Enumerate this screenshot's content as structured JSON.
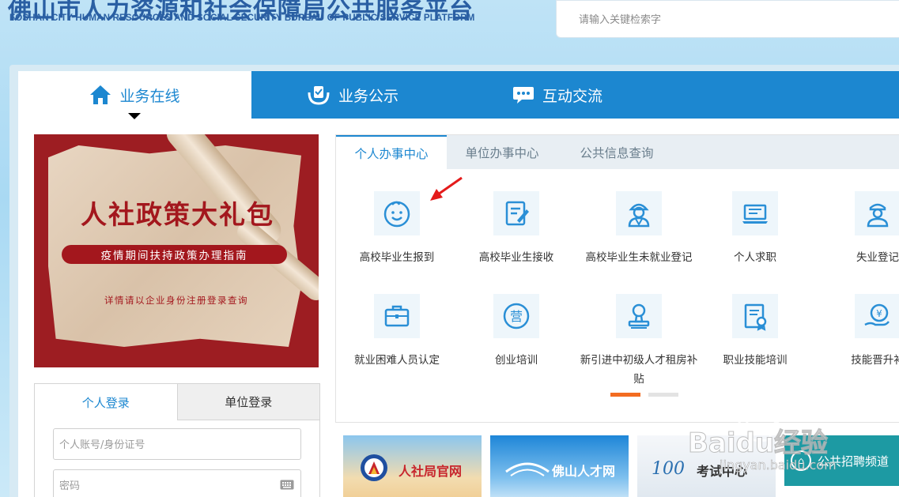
{
  "header": {
    "title": "佛山市人力资源和社会保障局公共服务平台",
    "subtitle": "FOSHAN CITY HUMAN RESOURCES AND SOCIAL SECURITY BUREAU OF PUBLIC SERVICE PLATFORM",
    "search_placeholder": "请输入关键检索字"
  },
  "main_tabs": [
    {
      "label": "业务在线",
      "icon": "home-icon"
    },
    {
      "label": "业务公示",
      "icon": "clipboard-check-icon"
    },
    {
      "label": "互动交流",
      "icon": "chat-bubble-icon"
    }
  ],
  "banner": {
    "title": "人社政策大礼包",
    "pill": "疫情期间扶持政策办理指南",
    "note": "详情请以企业身份注册登录查询"
  },
  "login": {
    "tabs": [
      "个人登录",
      "单位登录"
    ],
    "account_placeholder": "个人账号/身份证号",
    "password_placeholder": "密码"
  },
  "service": {
    "tabs": [
      "个人办事中心",
      "单位办事中心",
      "公共信息查询"
    ],
    "items_row1": [
      {
        "label": "高校毕业生报到",
        "icon": "baby-face-icon"
      },
      {
        "label": "高校毕业生接收",
        "icon": "document-edit-icon"
      },
      {
        "label": "高校毕业生未就业登记",
        "icon": "worker-icon"
      },
      {
        "label": "个人求职",
        "icon": "computer-icon"
      },
      {
        "label": "失业登记",
        "icon": "person-cap-icon"
      }
    ],
    "items_row2": [
      {
        "label": "就业困难人员认定",
        "icon": "briefcase-icon"
      },
      {
        "label": "创业培训",
        "icon": "ying-circle-icon"
      },
      {
        "label": "新引进中初级人才租房补贴",
        "icon": "stamp-icon"
      },
      {
        "label": "职业技能培训",
        "icon": "certificate-icon"
      },
      {
        "label": "技能晋升补",
        "icon": "yuan-hand-icon"
      }
    ]
  },
  "cards": [
    {
      "label": "人社局官网"
    },
    {
      "label": "佛山人才网"
    },
    {
      "label": "考试中心"
    }
  ],
  "recruit": {
    "label": "公共招聘频道"
  },
  "watermark": {
    "brand": "Baidu经验",
    "url": "jingyan.baidu.com"
  },
  "colors": {
    "primary": "#1c87d0",
    "accent": "#f36c21",
    "banner_red": "#9d1d22"
  }
}
